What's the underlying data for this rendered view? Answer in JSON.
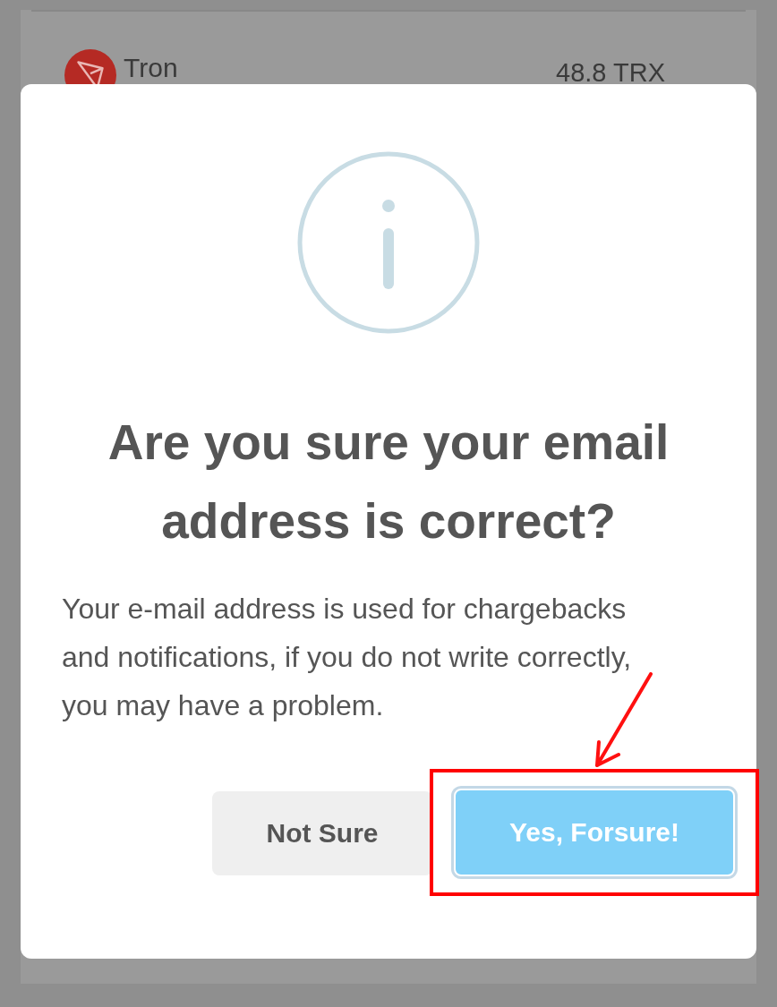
{
  "background": {
    "asset": {
      "name": "Tron",
      "amount": "48.8 TRX"
    }
  },
  "dialog": {
    "title": "Are you sure your email address is correct?",
    "message": "Your e-mail address is used for chargebacks and notifications, if you do not write correctly, you may have a problem.",
    "buttons": [
      {
        "label": "Not Sure",
        "kind": "secondary",
        "highlighted": false
      },
      {
        "label": "Yes, Forsure!",
        "kind": "primary",
        "highlighted": true
      }
    ]
  }
}
